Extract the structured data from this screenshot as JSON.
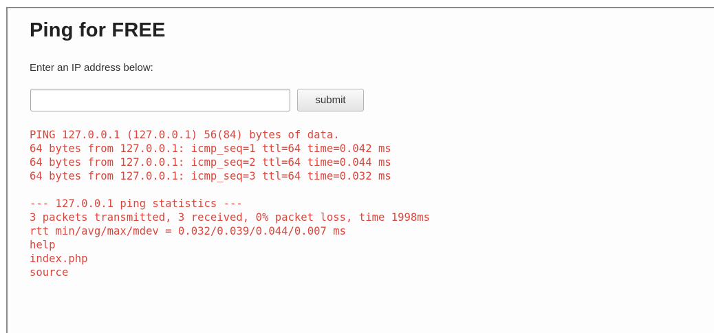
{
  "page": {
    "title": "Ping for FREE",
    "prompt": "Enter an IP address below:"
  },
  "form": {
    "ip_input_value": "",
    "ip_input_placeholder": "",
    "submit_label": "submit"
  },
  "output": {
    "ping_lines": [
      "PING 127.0.0.1 (127.0.0.1) 56(84) bytes of data.",
      "64 bytes from 127.0.0.1: icmp_seq=1 ttl=64 time=0.042 ms",
      "64 bytes from 127.0.0.1: icmp_seq=2 ttl=64 time=0.044 ms",
      "64 bytes from 127.0.0.1: icmp_seq=3 ttl=64 time=0.032 ms"
    ],
    "stats_lines": [
      "--- 127.0.0.1 ping statistics ---",
      "3 packets transmitted, 3 received, 0% packet loss, time 1998ms",
      "rtt min/avg/max/mdev = 0.032/0.039/0.044/0.007 ms"
    ],
    "file_listing": [
      "help",
      "index.php",
      "source"
    ]
  },
  "colors": {
    "output_text": "#d9473e",
    "title_text": "#222222"
  }
}
